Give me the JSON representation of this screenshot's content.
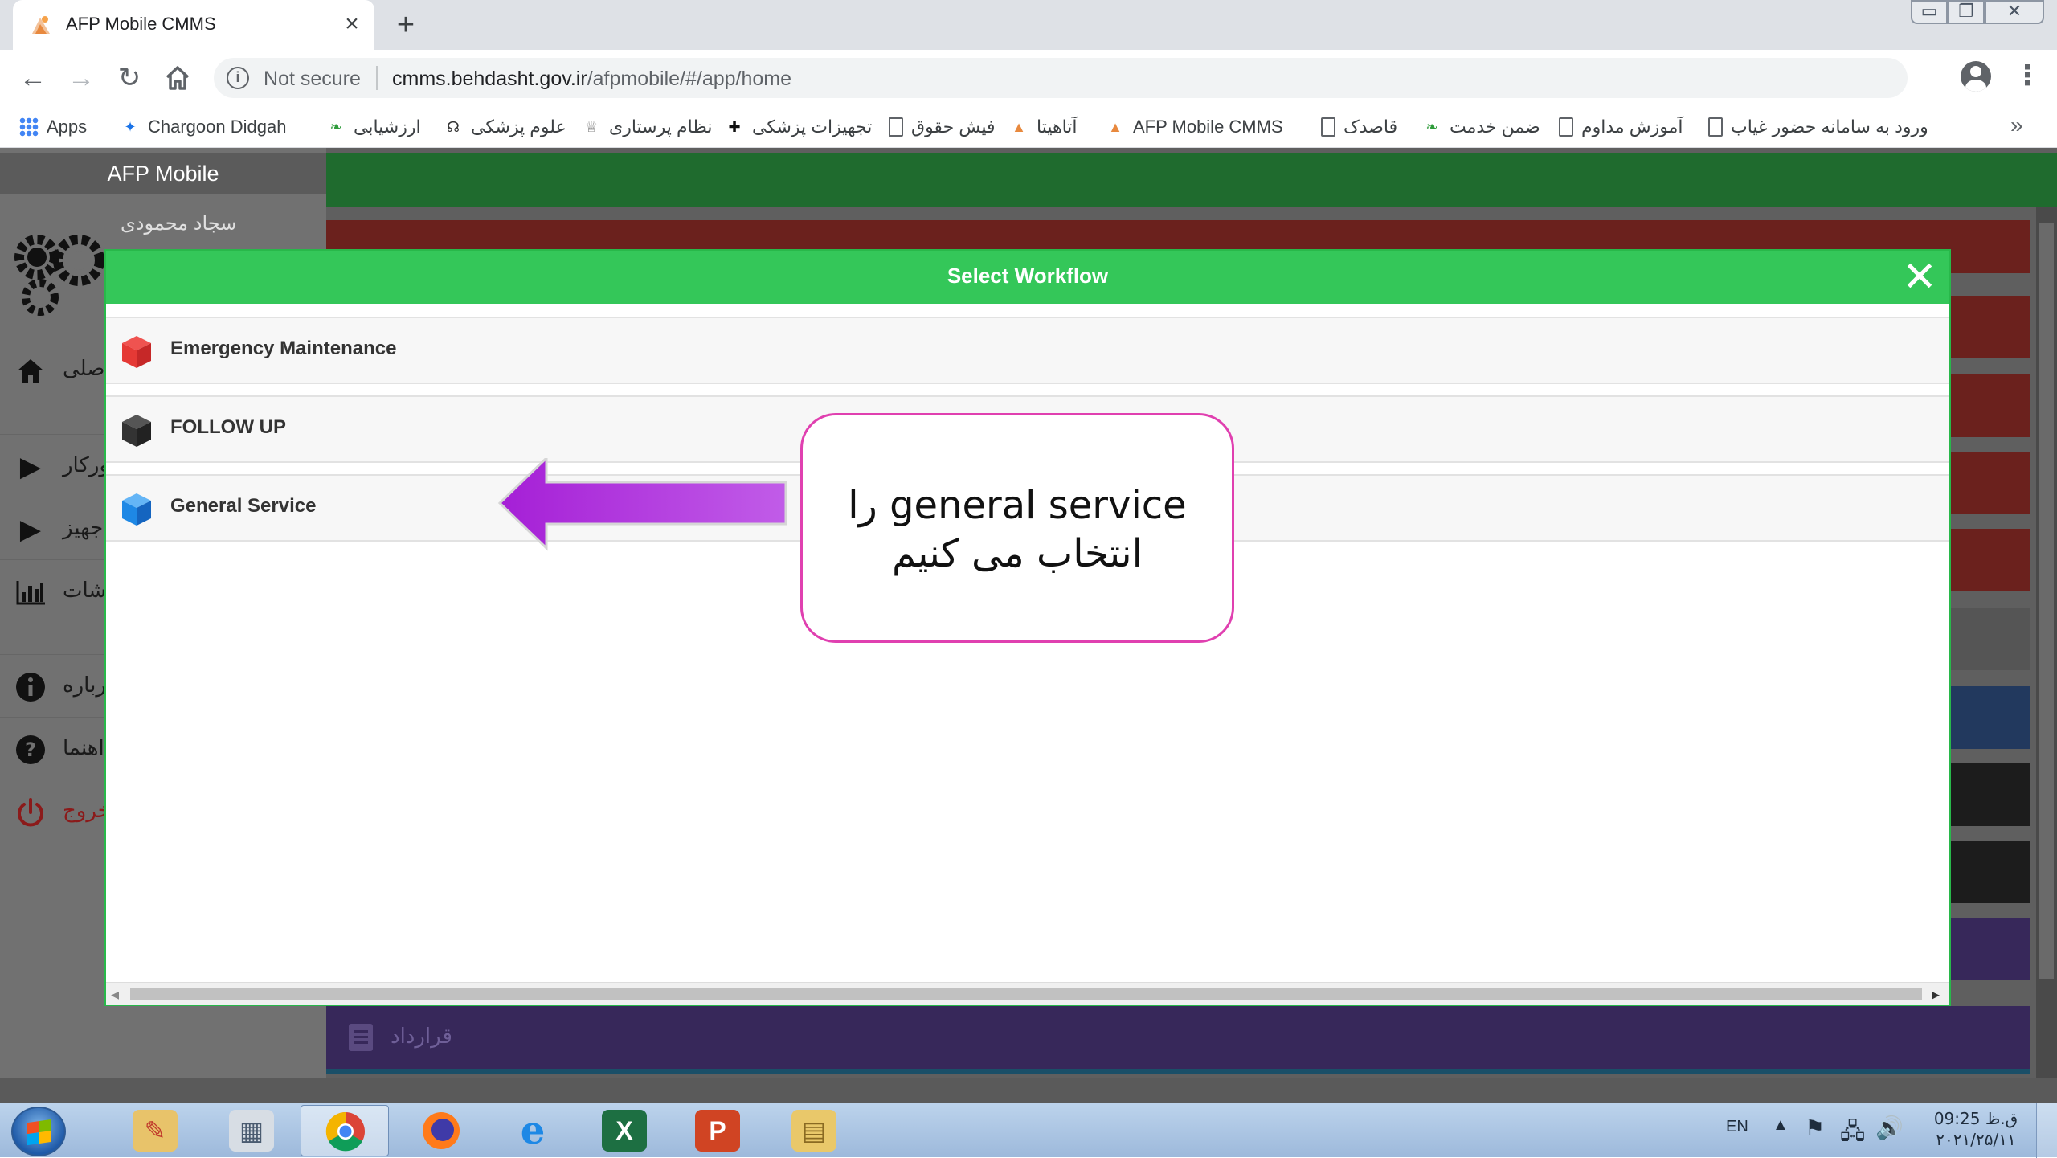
{
  "browser": {
    "tab_title": "AFP Mobile CMMS",
    "tab_close": "×",
    "new_tab": "+",
    "security_label": "Not secure",
    "url_host": "cmms.behdasht.gov.ir",
    "url_path": "/afpmobile/#/app/home",
    "window_min": "▭",
    "window_max": "❐",
    "window_close": "✕"
  },
  "bookmarks": [
    {
      "label": "Apps",
      "icon": "apps-grid-icon"
    },
    {
      "label": "Chargoon Didgah",
      "icon": "chargoon-icon"
    },
    {
      "label": "ارزشیابی",
      "icon": "leaf-icon"
    },
    {
      "label": "علوم پزشکی",
      "icon": "people-icon"
    },
    {
      "label": "نظام پرستاری",
      "icon": "nursing-icon"
    },
    {
      "label": "تجهیزات پزشکی",
      "icon": "medkit-icon"
    },
    {
      "label": "فیش حقوق",
      "icon": "document-icon"
    },
    {
      "label": "آتاهیتا",
      "icon": "afp-logo-icon"
    },
    {
      "label": "AFP Mobile CMMS",
      "icon": "afp-logo-icon"
    },
    {
      "label": "قاصدک",
      "icon": "document-icon"
    },
    {
      "label": "ضمن خدمت",
      "icon": "leaf-icon"
    },
    {
      "label": "آموزش مداوم",
      "icon": "document-icon"
    },
    {
      "label": "ورود به سامانه حضور غیاب",
      "icon": "document-icon"
    }
  ],
  "bookmarks_more": "»",
  "app": {
    "sidebar_title": "AFP Mobile",
    "user_name": "سجاد محمودی",
    "nav": [
      {
        "label": "صلی",
        "icon": "home-icon"
      },
      {
        "label": "ورکار",
        "icon": "caret-right-icon"
      },
      {
        "label": "جهیز",
        "icon": "caret-right-icon"
      },
      {
        "label": "شات",
        "icon": "bar-chart-icon"
      },
      {
        "label": "درباره",
        "icon": "info-icon"
      },
      {
        "label": "اهنما",
        "icon": "help-icon"
      },
      {
        "label": "خروج",
        "icon": "power-icon"
      }
    ],
    "contract_tile": "قرارداد"
  },
  "modal": {
    "title": "Select Workflow",
    "close": "✕",
    "workflows": [
      {
        "label": "Emergency Maintenance",
        "color": "#e53935",
        "icon": "red-cube-icon"
      },
      {
        "label": "FOLLOW UP",
        "color": "#333333",
        "icon": "black-cube-icon"
      },
      {
        "label": "General Service",
        "color": "#1e88e5",
        "icon": "blue-cube-icon"
      }
    ]
  },
  "annotation": {
    "line1": "general service را",
    "line2": "انتخاب  می کنیم",
    "arrow_color": "#b62ee0",
    "border_color": "#e040b0"
  },
  "taskbar": {
    "lang": "EN",
    "time": "09:25 ق.ظ",
    "date": "۲۰۲۱/۲۵/۱۱",
    "apps": [
      "paint-icon",
      "calculator-icon",
      "chrome-icon",
      "firefox-icon",
      "ie-icon",
      "excel-icon",
      "powerpoint-icon",
      "explorer-icon"
    ]
  }
}
